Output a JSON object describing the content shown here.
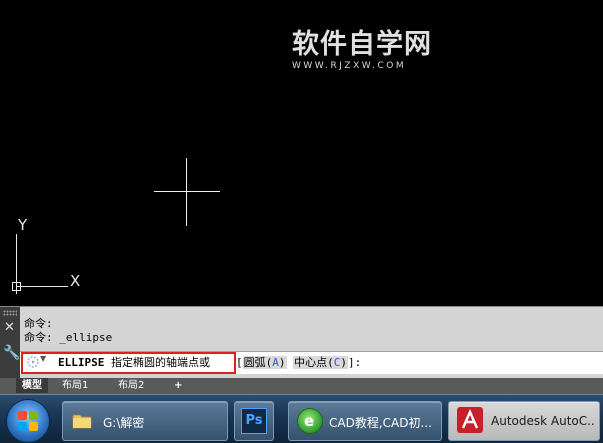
{
  "watermark": {
    "title": "软件自学网",
    "url": "WWW.RJZXW.COM"
  },
  "ucs": {
    "y_label": "Y",
    "x_label": "X"
  },
  "command_history": [
    "命令:",
    "命令: _ellipse"
  ],
  "command_line": {
    "command": "ELLIPSE",
    "prompt": "指定椭圆的轴端点或",
    "open_bracket": "[",
    "options": [
      {
        "label": "圆弧(",
        "key": "A",
        "close": ")"
      },
      {
        "label": "中心点(",
        "key": "C",
        "close": ")"
      }
    ],
    "close_bracket": "]:"
  },
  "layout_tabs": [
    "模型",
    "布局1",
    "布局2",
    "+"
  ],
  "active_tab": "模型",
  "taskbar": {
    "items": [
      {
        "label": "G:\\解密",
        "icon": "folder-icon"
      },
      {
        "label": "",
        "icon": "photoshop-icon",
        "icon_text": "Ps"
      },
      {
        "label": "CAD教程,CAD初...",
        "icon": "browser-icon"
      },
      {
        "label": "Autodesk AutoC...",
        "icon": "autocad-icon"
      }
    ]
  },
  "colors": {
    "canvas": "#000000",
    "highlight_box": "#e0201a",
    "option_key": "#3355cc"
  }
}
